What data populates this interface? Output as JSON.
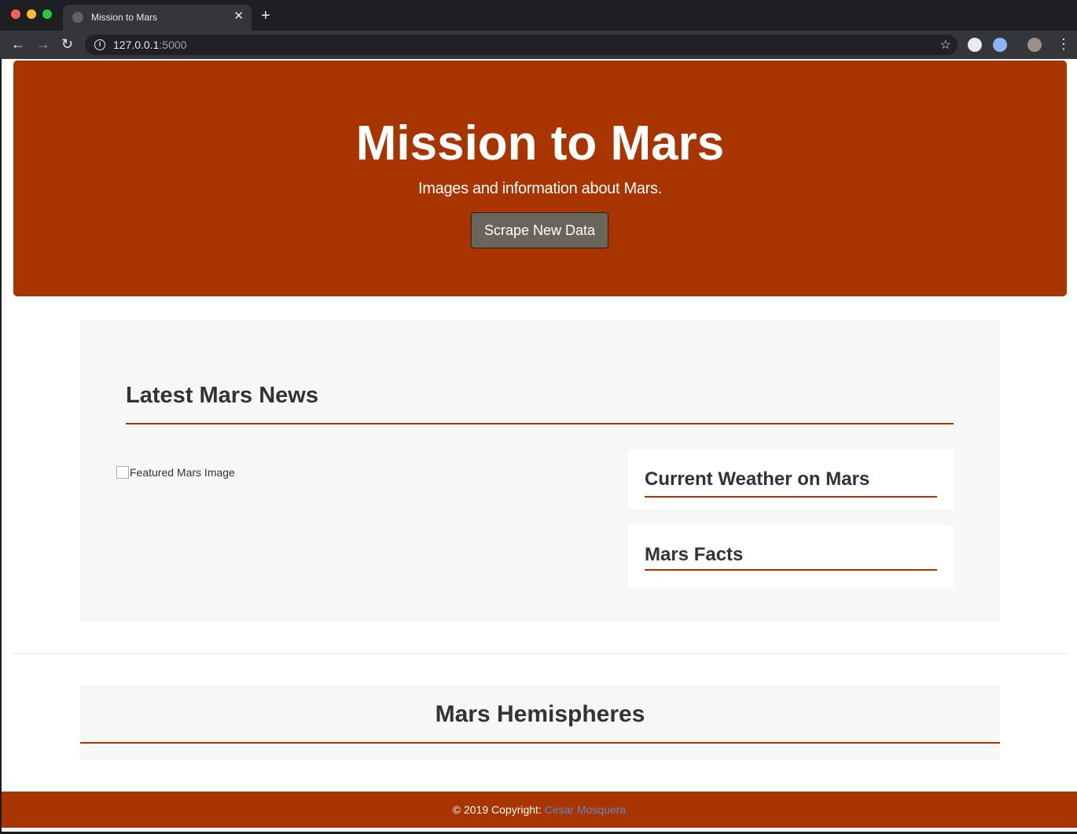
{
  "browser": {
    "tab_title": "Mission to Mars",
    "new_tab_label": "+",
    "close_label": "✕",
    "url_host": "127.0.0.1",
    "url_port": ":5000"
  },
  "hero": {
    "title": "Mission to Mars",
    "subtitle": "Images and information about Mars.",
    "button_label": "Scrape New Data"
  },
  "news": {
    "heading": "Latest Mars News",
    "featured_image_alt": "Featured Mars Image",
    "weather_heading": "Current Weather on Mars",
    "facts_heading": "Mars Facts"
  },
  "hemispheres": {
    "heading": "Mars Hemispheres"
  },
  "footer": {
    "copyright": "© 2019 Copyright: ",
    "author": "Cesar Mosquera"
  },
  "colors": {
    "brand": "#a83400",
    "button": "#6a655b",
    "panel": "#f7f7f7",
    "link": "#5b8bc7"
  },
  "icons": [
    "back-arrow-icon",
    "forward-arrow-icon",
    "reload-icon",
    "info-icon",
    "star-icon",
    "menu-icon",
    "globe-icon",
    "close-icon",
    "plus-icon"
  ]
}
